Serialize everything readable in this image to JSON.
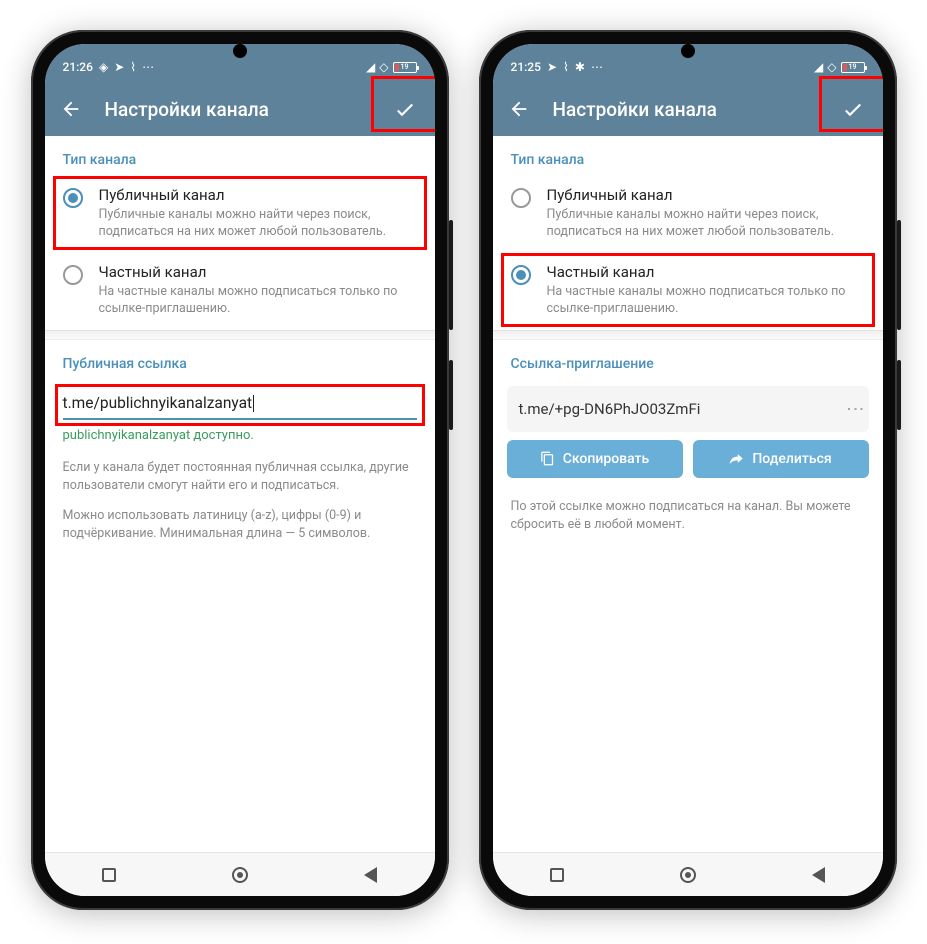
{
  "phones": {
    "left": {
      "status": {
        "time": "21:26",
        "battery": "19"
      },
      "appbar": {
        "title": "Настройки канала"
      },
      "type_section": "Тип канала",
      "public": {
        "title": "Публичный канал",
        "desc": "Публичные каналы можно найти через поиск, подписаться на них может любой пользователь."
      },
      "private": {
        "title": "Частный канал",
        "desc": "На частные каналы можно подписаться только по ссылке-приглашению."
      },
      "link_section": "Публичная ссылка",
      "link_value": "t.me/publichnyikanalzanyat",
      "avail": "publichnyikanalzanyat доступно.",
      "help1": "Если у канала будет постоянная публичная ссылка, другие пользователи смогут найти его и подписаться.",
      "help2": "Можно использовать латиницу (a-z), цифры (0-9) и подчёркивание. Минимальная длина — 5 символов."
    },
    "right": {
      "status": {
        "time": "21:25",
        "battery": "19"
      },
      "appbar": {
        "title": "Настройки канала"
      },
      "type_section": "Тип канала",
      "public": {
        "title": "Публичный канал",
        "desc": "Публичные каналы можно найти через поиск, подписаться на них может любой пользователь."
      },
      "private": {
        "title": "Частный канал",
        "desc": "На частные каналы можно подписаться только по ссылке-приглашению."
      },
      "invite_section": "Ссылка-приглашение",
      "invite_link": "t.me/+pg-DN6PhJO03ZmFi",
      "copy_btn": "Скопировать",
      "share_btn": "Поделиться",
      "help": "По этой ссылке можно подписаться на канал. Вы можете сбросить её в любой момент."
    }
  }
}
